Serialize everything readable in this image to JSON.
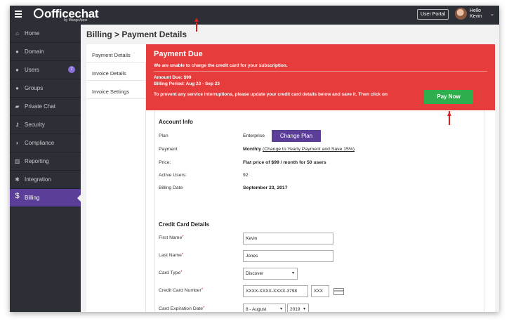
{
  "brand": {
    "name": "officechat",
    "sub": "by MangoApps"
  },
  "topbar": {
    "user_portal": "User Portal",
    "hello": "Hello",
    "user": "Kevin"
  },
  "sidebar": {
    "items": [
      {
        "label": "Home",
        "icon": "home-icon"
      },
      {
        "label": "Domain",
        "icon": "globe-icon"
      },
      {
        "label": "Users",
        "icon": "user-icon",
        "badge": "7"
      },
      {
        "label": "Groups",
        "icon": "groups-icon"
      },
      {
        "label": "Private Chat",
        "icon": "chat-icon"
      },
      {
        "label": "Security",
        "icon": "key-icon"
      },
      {
        "label": "Compliance",
        "icon": "shield-icon"
      },
      {
        "label": "Reporting",
        "icon": "chart-icon"
      },
      {
        "label": "Integration",
        "icon": "gear-icon"
      },
      {
        "label": "Billing",
        "icon": "dollar-icon"
      }
    ]
  },
  "page": {
    "title": "Billing > Payment Details"
  },
  "tabs": [
    "Payment Details",
    "Invoice Details",
    "Invoice Settings"
  ],
  "alert": {
    "title": "Payment Due",
    "message": "We are unable to charge the credit card for your subscription.",
    "amount": "Amount Due: $99",
    "period": "Billing Period: Aug 23 - Sep 23",
    "cta": "To prevent any service interruptions, please update your credit card details below and save it. Then click on",
    "pay_now": "Pay Now",
    "color": "#e63c3c",
    "button_color": "#2fae4d"
  },
  "account": {
    "heading": "Account Info",
    "plan_label": "Plan",
    "plan_value": "Enterprise",
    "change_plan": "Change Plan",
    "payment_label": "Payment",
    "payment_value": "Monthly",
    "payment_link": "(Change to Yearly Payment and Save 15%)",
    "price_label": "Price:",
    "price_value": "Flat price of $99 / month for 50 users",
    "users_label": "Active Users:",
    "users_value": "92",
    "billing_label": "Billing Date",
    "billing_value": "September 23, 2017"
  },
  "card": {
    "heading": "Credit Card Details",
    "first_name_label": "First Name",
    "first_name": "Kevin",
    "last_name_label": "Last Name",
    "last_name": "Jones",
    "type_label": "Card Type",
    "type_value": "Discover",
    "number_label": "Credit Card Number",
    "number_value": "XXXX-XXXX-XXXX-3798",
    "cvv_value": "XXX",
    "expiry_label": "Card Expiration Date",
    "expiry_month": "8 - August",
    "expiry_year": "2019"
  },
  "accent": "#5b3e97"
}
